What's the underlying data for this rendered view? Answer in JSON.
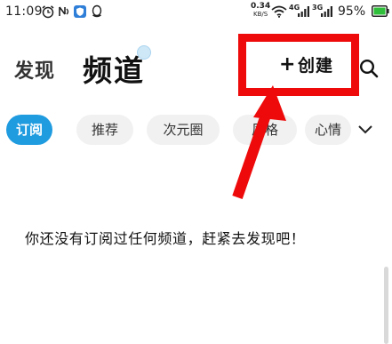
{
  "status_bar": {
    "time": "11:09",
    "net_speed": "0.34",
    "net_unit": "KB/S",
    "signal_1": "4G",
    "signal_2": "3G",
    "battery": "95%"
  },
  "header": {
    "tab_discover": "发现",
    "tab_channel": "频道",
    "create_plus": "+",
    "create_label": "创建"
  },
  "chips": [
    {
      "label": "订阅",
      "active": true
    },
    {
      "label": "推荐",
      "active": false
    },
    {
      "label": "次元圈",
      "active": false
    },
    {
      "label": "风格",
      "active": false
    },
    {
      "label": "心情",
      "active": false
    }
  ],
  "empty_state": {
    "message": "你还没有订阅过任何频道，赶紧去发现吧！"
  },
  "colors": {
    "accent": "#1f9be0",
    "annotation": "#ee0a0a"
  }
}
